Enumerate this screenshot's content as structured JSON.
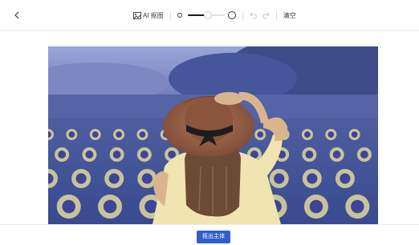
{
  "toolbar": {
    "back_icon": "chevron-left-icon",
    "ai_cutout_label": "AI 抠图",
    "ai_cutout_icon": "image-icon",
    "brush_size_percent": 55,
    "undo_icon": "undo-icon",
    "redo_icon": "redo-icon",
    "clear_label": "清空"
  },
  "canvas": {
    "image": "woman-in-straw-hat-sunflower-field"
  },
  "footer": {
    "primary_button_label": "抠出主体",
    "primary_button_color": "#2f5fcc"
  }
}
